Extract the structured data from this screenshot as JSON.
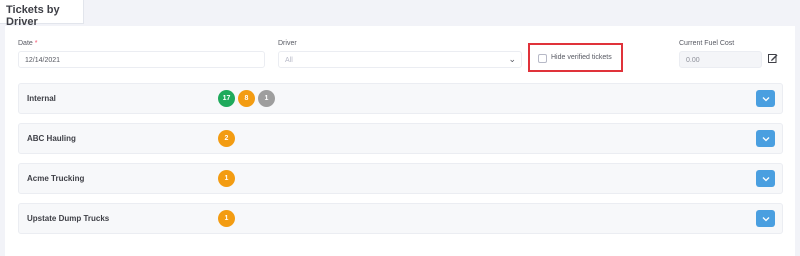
{
  "page": {
    "tab_title": "Tickets by Driver"
  },
  "filters": {
    "date": {
      "label": "Date",
      "required_mark": "*",
      "value": "12/14/2021"
    },
    "driver": {
      "label": "Driver",
      "selected": "All"
    },
    "hide_verified": {
      "label": "Hide verified tickets",
      "checked": false
    },
    "fuel_cost": {
      "label": "Current Fuel Cost",
      "value": "0.00"
    }
  },
  "drivers": [
    {
      "name": "Internal",
      "badges": [
        {
          "count": "17",
          "color": "#1faa5c"
        },
        {
          "count": "8",
          "color": "#f39c12"
        },
        {
          "count": "1",
          "color": "#9e9e9e"
        }
      ]
    },
    {
      "name": "ABC Hauling",
      "badges": [
        {
          "count": "2",
          "color": "#f39c12"
        }
      ]
    },
    {
      "name": "Acme Trucking",
      "badges": [
        {
          "count": "1",
          "color": "#f39c12"
        }
      ]
    },
    {
      "name": "Upstate Dump Trucks",
      "badges": [
        {
          "count": "1",
          "color": "#f39c12"
        }
      ]
    }
  ],
  "colors": {
    "accent": "#4a9fe0",
    "highlight_border": "#e0323a"
  }
}
